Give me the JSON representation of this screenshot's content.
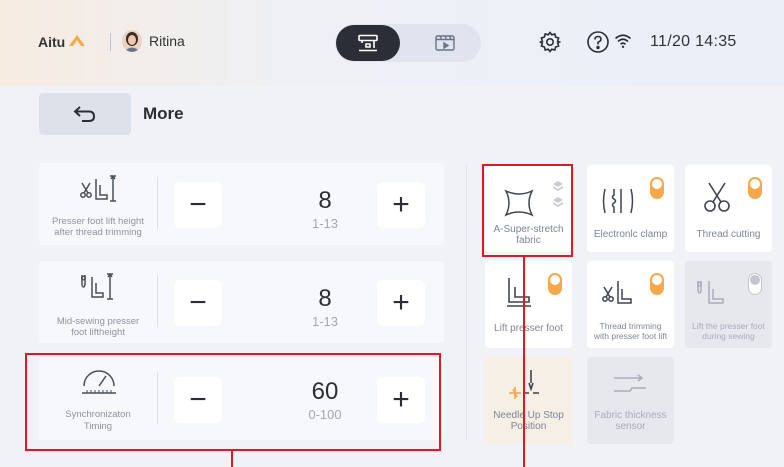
{
  "header": {
    "brand": "Aitu",
    "user_name": "Ritina",
    "datetime": "11/20 14:35"
  },
  "subbar": {
    "title": "More"
  },
  "settings": [
    {
      "label_line1": "Presser foot lift height",
      "label_line2": "after thread trimming",
      "value": "8",
      "range": "1-13",
      "minus": "−",
      "plus": "+"
    },
    {
      "label_line1": "Mid-sewing presser",
      "label_line2": "foot liftheight",
      "value": "8",
      "range": "1-13",
      "minus": "−",
      "plus": "+"
    },
    {
      "label_line1": "Synchronizaton",
      "label_line2": "Timing",
      "value": "60",
      "range": "0-100",
      "minus": "−",
      "plus": "+"
    }
  ],
  "tiles": [
    {
      "line1": "A-Super-stretch",
      "line2": "fabric",
      "state": "selectable"
    },
    {
      "line1": "Electronlc clamp",
      "line2": "",
      "toggle": "on"
    },
    {
      "line1": "Thread cutting",
      "line2": "",
      "toggle": "on"
    },
    {
      "line1": "Lift presser foot",
      "line2": "",
      "toggle": "on"
    },
    {
      "line1": "Thread trimming",
      "line2": "with presser foot lift",
      "toggle": "on"
    },
    {
      "line1": "Lift the presser foot",
      "line2": "during sewing",
      "toggle": "off",
      "state": "disabled"
    },
    {
      "line1": "Needle Up Stop",
      "line2": "Position",
      "state": "inactive"
    },
    {
      "line1": "Fabric thickness",
      "line2": "sensor",
      "state": "disabled"
    }
  ],
  "colors": {
    "accent": "#f7a84a",
    "highlight": "#e3171f",
    "dark": "#2b2e36"
  }
}
